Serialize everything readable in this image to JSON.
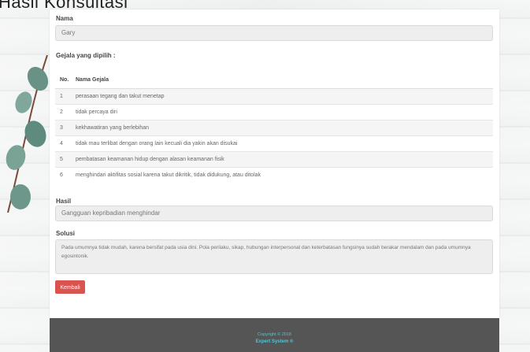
{
  "page": {
    "title": "Hasil Konsultasi"
  },
  "form": {
    "nama_label": "Nama",
    "nama_value": "Gary",
    "gejala_label": "Gejala yang dipilih :",
    "table_headers": [
      "No.",
      "Nama Gejala"
    ],
    "rows": [
      {
        "no": "1",
        "gejala": "perasaan tegang dan takut menetap"
      },
      {
        "no": "2",
        "gejala": "tidak percaya diri"
      },
      {
        "no": "3",
        "gejala": "kekhawatiran yang berlebihan"
      },
      {
        "no": "4",
        "gejala": "tidak mau terlibat dengan orang lain kecuali dia yakin akan disukai"
      },
      {
        "no": "5",
        "gejala": "pembatasan keamanan hidup dengan alasan keamanan fisik"
      },
      {
        "no": "6",
        "gejala": "menghindari aktifitas sosial karena takut dikritik, tidak didukung, atau ditolak"
      }
    ],
    "hasil_label": "Hasil",
    "hasil_value": "Gangguan kepribadian menghindar",
    "solusi_label": "Solusi",
    "solusi_value": "Pada umumnya tidak mudah, karena bersifat pada usia dini. Pola perilaku, sikap, hubungan interpersonal dan keterbatasan fungsinya sudah berakar mendalam dan pada umumnya egosintonik.",
    "kembali_label": "Kembali"
  },
  "footer": {
    "copyright": "Copyright © 2018",
    "brand": "Expert System ®"
  },
  "colors": {
    "button": "#d9534f",
    "footer_bg": "#555555",
    "footer_text": "#4ec6d8"
  }
}
